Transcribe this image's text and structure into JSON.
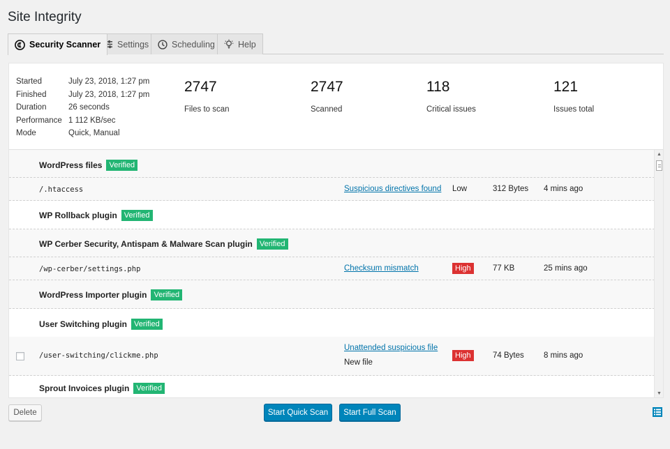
{
  "page": {
    "title": "Site Integrity"
  },
  "tabs": [
    {
      "label": "Security Scanner",
      "icon": "cerber-logo-icon",
      "active": true
    },
    {
      "label": "Settings",
      "icon": "sliders-icon",
      "active": false
    },
    {
      "label": "Scheduling",
      "icon": "clock-icon",
      "active": false
    },
    {
      "label": "Help",
      "icon": "lightbulb-icon",
      "active": false
    }
  ],
  "summary": {
    "meta": [
      {
        "label": "Started",
        "value": "July 23, 2018, 1:27 pm"
      },
      {
        "label": "Finished",
        "value": "July 23, 2018, 1:27 pm"
      },
      {
        "label": "Duration",
        "value": "26 seconds"
      },
      {
        "label": "Performance",
        "value": "1 112 KB/sec"
      },
      {
        "label": "Mode",
        "value": "Quick, Manual"
      }
    ],
    "stats": [
      {
        "value": "2747",
        "label": "Files to scan"
      },
      {
        "value": "2747",
        "label": "Scanned"
      },
      {
        "value": "118",
        "label": "Critical issues"
      },
      {
        "value": "121",
        "label": "Issues total"
      }
    ]
  },
  "sections": [
    {
      "title": "WordPress files",
      "badge": "Verified",
      "files": [
        {
          "path": "/.htaccess",
          "issue": "Suspicious directives found",
          "severity": "Low",
          "size": "312 Bytes",
          "time": "4 mins ago"
        }
      ]
    },
    {
      "title": "WP Rollback plugin",
      "badge": "Verified",
      "files": []
    },
    {
      "title": "WP Cerber Security, Antispam & Malware Scan plugin",
      "badge": "Verified",
      "files": [
        {
          "path": "/wp-cerber/settings.php",
          "issue": "Checksum mismatch",
          "severity": "High",
          "size": "77 KB",
          "time": "25 mins ago"
        }
      ]
    },
    {
      "title": "WordPress Importer plugin",
      "badge": "Verified",
      "files": []
    },
    {
      "title": "User Switching plugin",
      "badge": "Verified",
      "files": [
        {
          "path": "/user-switching/clickme.php",
          "issue": "Unattended suspicious file",
          "issue_sub": "New file",
          "severity": "High",
          "size": "74 Bytes",
          "time": "8 mins ago"
        }
      ]
    },
    {
      "title": "Sprout Invoices plugin",
      "badge": "Verified",
      "files": []
    }
  ],
  "actions": {
    "delete": "Delete",
    "quick_scan": "Start Quick Scan",
    "full_scan": "Start Full Scan"
  },
  "colors": {
    "verified": "#22b573",
    "high": "#dc3232",
    "link": "#0073aa",
    "primary": "#0085ba"
  }
}
